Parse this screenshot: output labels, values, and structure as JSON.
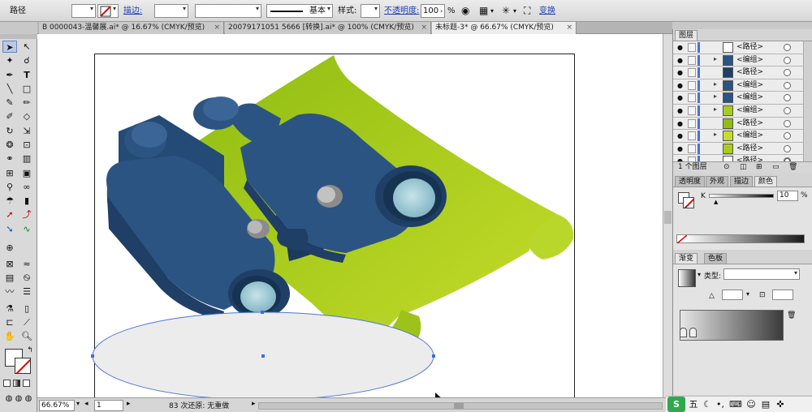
{
  "control_bar": {
    "object_type": "路径",
    "stroke_label": "描边:",
    "brush_label": "基本",
    "style_label": "样式:",
    "opacity_label": "不透明度:",
    "opacity_value": "100",
    "opacity_unit": "%",
    "transform_label": "变换"
  },
  "tabs": [
    {
      "label": "B 0000043-温馨展.ai* @ 16.67% (CMYK/预览)",
      "close": "×"
    },
    {
      "label": "20079171051 5666  [转换].ai* @ 100% (CMYK/预览)",
      "close": "×"
    },
    {
      "label": "未标题-3* @ 66.67% (CMYK/预览)",
      "close": "×"
    }
  ],
  "status": {
    "zoom": "66.67%",
    "page": "1",
    "undo_info": "83 次还原: 无重做"
  },
  "layers_panel": {
    "tab": "图层",
    "rows": [
      {
        "name": "<路径>",
        "expandable": false
      },
      {
        "name": "<编组>",
        "expandable": true
      },
      {
        "name": "<路径>",
        "expandable": false
      },
      {
        "name": "<编组>",
        "expandable": true
      },
      {
        "name": "<编组>",
        "expandable": true
      },
      {
        "name": "<编组>",
        "expandable": true
      },
      {
        "name": "<路径>",
        "expandable": false
      },
      {
        "name": "<编组>",
        "expandable": true
      },
      {
        "name": "<路径>",
        "expandable": false
      },
      {
        "name": "<路径>",
        "expandable": false
      }
    ],
    "footer": "1 个图层"
  },
  "color_panel": {
    "tabs": [
      "透明度",
      "外观",
      "描边",
      "颜色"
    ],
    "channel": "K",
    "value": "10",
    "unit": "%"
  },
  "gradient_panel": {
    "tabs": [
      "渐变",
      "色板"
    ],
    "type_label": "类型:"
  },
  "ime_bar": {
    "logo": "S",
    "mode": "五"
  },
  "colors": {
    "binocular": "#2c5482",
    "paper": "#a9cd1f",
    "selection": "#3a6fd8",
    "accent_link": "#1d3fb8"
  }
}
